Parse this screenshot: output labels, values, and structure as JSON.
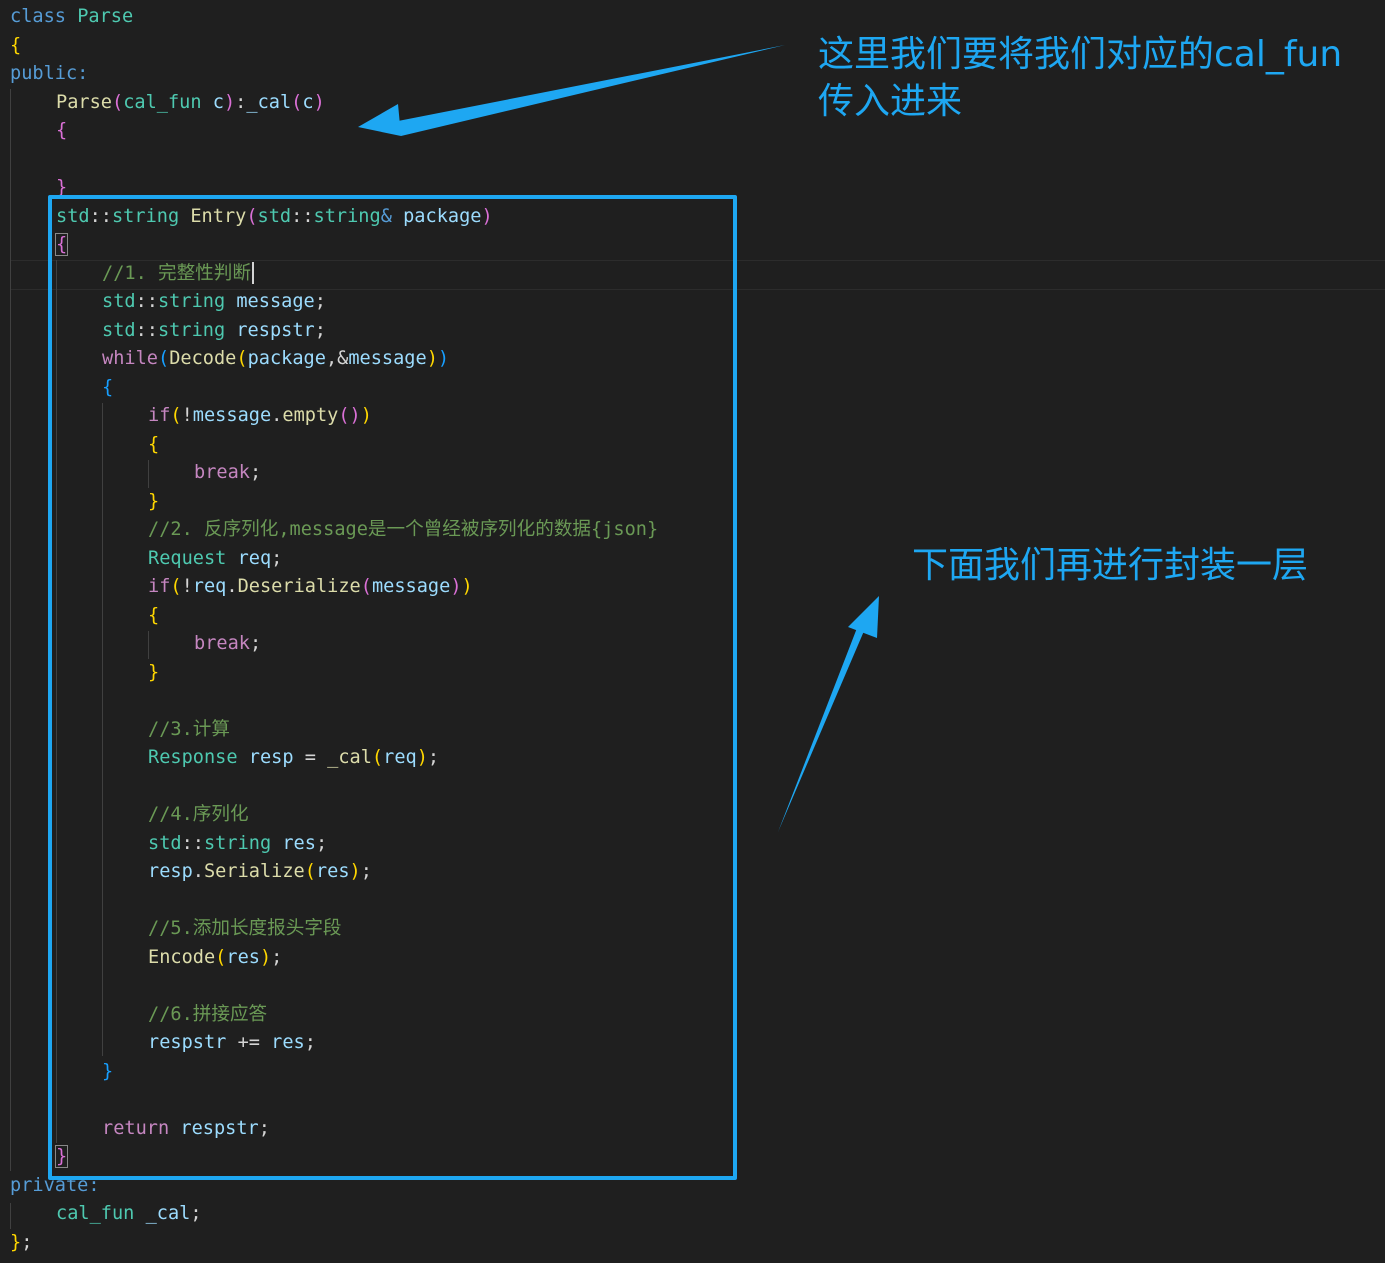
{
  "editor": {
    "lines": [
      {
        "indent": 0,
        "tokens": [
          [
            "kw",
            "class"
          ],
          [
            "pl",
            " "
          ],
          [
            "ty",
            "Parse"
          ]
        ]
      },
      {
        "indent": 0,
        "tokens": [
          [
            "b1",
            "{"
          ]
        ]
      },
      {
        "indent": 0,
        "tokens": [
          [
            "kw",
            "public:"
          ]
        ]
      },
      {
        "indent": 1,
        "tokens": [
          [
            "fn",
            "Parse"
          ],
          [
            "b2",
            "("
          ],
          [
            "ty",
            "cal_fun"
          ],
          [
            "pl",
            " "
          ],
          [
            "var",
            "c"
          ],
          [
            "b2",
            ")"
          ],
          [
            "pl",
            ":"
          ],
          [
            "var",
            "_cal"
          ],
          [
            "b2",
            "("
          ],
          [
            "var",
            "c"
          ],
          [
            "b2",
            ")"
          ]
        ]
      },
      {
        "indent": 1,
        "tokens": [
          [
            "b2",
            "{"
          ]
        ]
      },
      {
        "indent": 1,
        "tokens": []
      },
      {
        "indent": 1,
        "tokens": [
          [
            "b2",
            "}"
          ]
        ]
      },
      {
        "indent": 1,
        "tokens": [
          [
            "ty",
            "std"
          ],
          [
            "pl",
            "::"
          ],
          [
            "ty",
            "string"
          ],
          [
            "pl",
            " "
          ],
          [
            "fn",
            "Entry"
          ],
          [
            "b2",
            "("
          ],
          [
            "ty",
            "std"
          ],
          [
            "pl",
            "::"
          ],
          [
            "ty",
            "string"
          ],
          [
            "kw",
            "&"
          ],
          [
            "pl",
            " "
          ],
          [
            "var",
            "package"
          ],
          [
            "b2",
            ")"
          ]
        ]
      },
      {
        "indent": 1,
        "tokens": [
          [
            "b2",
            "{"
          ]
        ]
      },
      {
        "indent": 2,
        "tokens": [
          [
            "cm",
            "//1. 完整性判断"
          ]
        ],
        "caret": true
      },
      {
        "indent": 2,
        "tokens": [
          [
            "ty",
            "std"
          ],
          [
            "pl",
            "::"
          ],
          [
            "ty",
            "string"
          ],
          [
            "pl",
            " "
          ],
          [
            "var",
            "message"
          ],
          [
            "pl",
            ";"
          ]
        ]
      },
      {
        "indent": 2,
        "tokens": [
          [
            "ty",
            "std"
          ],
          [
            "pl",
            "::"
          ],
          [
            "ty",
            "string"
          ],
          [
            "pl",
            " "
          ],
          [
            "var",
            "respstr"
          ],
          [
            "pl",
            ";"
          ]
        ]
      },
      {
        "indent": 2,
        "tokens": [
          [
            "ctl",
            "while"
          ],
          [
            "b3",
            "("
          ],
          [
            "fn",
            "Decode"
          ],
          [
            "b1",
            "("
          ],
          [
            "var",
            "package"
          ],
          [
            "pl",
            ",&"
          ],
          [
            "var",
            "message"
          ],
          [
            "b1",
            ")"
          ],
          [
            "b3",
            ")"
          ]
        ]
      },
      {
        "indent": 2,
        "tokens": [
          [
            "b3",
            "{"
          ]
        ]
      },
      {
        "indent": 3,
        "tokens": [
          [
            "ctl",
            "if"
          ],
          [
            "b1",
            "("
          ],
          [
            "pl",
            "!"
          ],
          [
            "var",
            "message"
          ],
          [
            "pl",
            "."
          ],
          [
            "fn",
            "empty"
          ],
          [
            "b2",
            "()"
          ],
          [
            "b1",
            ")"
          ]
        ]
      },
      {
        "indent": 3,
        "tokens": [
          [
            "b1",
            "{"
          ]
        ]
      },
      {
        "indent": 4,
        "tokens": [
          [
            "ctl",
            "break"
          ],
          [
            "pl",
            ";"
          ]
        ]
      },
      {
        "indent": 3,
        "tokens": [
          [
            "b1",
            "}"
          ]
        ]
      },
      {
        "indent": 3,
        "tokens": [
          [
            "cm",
            "//2. 反序列化,message是一个曾经被序列化的数据{json}"
          ]
        ]
      },
      {
        "indent": 3,
        "tokens": [
          [
            "ty",
            "Request"
          ],
          [
            "pl",
            " "
          ],
          [
            "var",
            "req"
          ],
          [
            "pl",
            ";"
          ]
        ]
      },
      {
        "indent": 3,
        "tokens": [
          [
            "ctl",
            "if"
          ],
          [
            "b1",
            "("
          ],
          [
            "pl",
            "!"
          ],
          [
            "var",
            "req"
          ],
          [
            "pl",
            "."
          ],
          [
            "fn",
            "Deserialize"
          ],
          [
            "b2",
            "("
          ],
          [
            "var",
            "message"
          ],
          [
            "b2",
            ")"
          ],
          [
            "b1",
            ")"
          ]
        ]
      },
      {
        "indent": 3,
        "tokens": [
          [
            "b1",
            "{"
          ]
        ]
      },
      {
        "indent": 4,
        "tokens": [
          [
            "ctl",
            "break"
          ],
          [
            "pl",
            ";"
          ]
        ]
      },
      {
        "indent": 3,
        "tokens": [
          [
            "b1",
            "}"
          ]
        ]
      },
      {
        "indent": 3,
        "tokens": []
      },
      {
        "indent": 3,
        "tokens": [
          [
            "cm",
            "//3.计算"
          ]
        ]
      },
      {
        "indent": 3,
        "tokens": [
          [
            "ty",
            "Response"
          ],
          [
            "pl",
            " "
          ],
          [
            "var",
            "resp"
          ],
          [
            "pl",
            " = "
          ],
          [
            "fn",
            "_cal"
          ],
          [
            "b1",
            "("
          ],
          [
            "var",
            "req"
          ],
          [
            "b1",
            ")"
          ],
          [
            "pl",
            ";"
          ]
        ]
      },
      {
        "indent": 3,
        "tokens": []
      },
      {
        "indent": 3,
        "tokens": [
          [
            "cm",
            "//4.序列化"
          ]
        ]
      },
      {
        "indent": 3,
        "tokens": [
          [
            "ty",
            "std"
          ],
          [
            "pl",
            "::"
          ],
          [
            "ty",
            "string"
          ],
          [
            "pl",
            " "
          ],
          [
            "var",
            "res"
          ],
          [
            "pl",
            ";"
          ]
        ]
      },
      {
        "indent": 3,
        "tokens": [
          [
            "var",
            "resp"
          ],
          [
            "pl",
            "."
          ],
          [
            "fn",
            "Serialize"
          ],
          [
            "b1",
            "("
          ],
          [
            "var",
            "res"
          ],
          [
            "b1",
            ")"
          ],
          [
            "pl",
            ";"
          ]
        ]
      },
      {
        "indent": 3,
        "tokens": []
      },
      {
        "indent": 3,
        "tokens": [
          [
            "cm",
            "//5.添加长度报头字段"
          ]
        ]
      },
      {
        "indent": 3,
        "tokens": [
          [
            "fn",
            "Encode"
          ],
          [
            "b1",
            "("
          ],
          [
            "var",
            "res"
          ],
          [
            "b1",
            ")"
          ],
          [
            "pl",
            ";"
          ]
        ]
      },
      {
        "indent": 3,
        "tokens": []
      },
      {
        "indent": 3,
        "tokens": [
          [
            "cm",
            "//6.拼接应答"
          ]
        ]
      },
      {
        "indent": 3,
        "tokens": [
          [
            "var",
            "respstr"
          ],
          [
            "pl",
            " += "
          ],
          [
            "var",
            "res"
          ],
          [
            "pl",
            ";"
          ]
        ]
      },
      {
        "indent": 2,
        "tokens": [
          [
            "b3",
            "}"
          ]
        ]
      },
      {
        "indent": 2,
        "tokens": []
      },
      {
        "indent": 2,
        "tokens": [
          [
            "ctl",
            "return"
          ],
          [
            "pl",
            " "
          ],
          [
            "var",
            "respstr"
          ],
          [
            "pl",
            ";"
          ]
        ]
      },
      {
        "indent": 1,
        "tokens": [
          [
            "b2",
            "}"
          ]
        ]
      },
      {
        "indent": 0,
        "tokens": [
          [
            "kw",
            "private:"
          ]
        ]
      },
      {
        "indent": 1,
        "tokens": [
          [
            "ty",
            "cal_fun"
          ],
          [
            "pl",
            " "
          ],
          [
            "var",
            "_cal"
          ],
          [
            "pl",
            ";"
          ]
        ]
      },
      {
        "indent": 0,
        "tokens": [
          [
            "b1",
            "}"
          ],
          [
            "pl",
            ";"
          ]
        ]
      }
    ]
  },
  "annotations": {
    "top_note": "这里我们要将我们对应的cal_fun\n传入进来",
    "right_note": "下面我们再进行封装一层",
    "color": "#1ea7f2"
  }
}
